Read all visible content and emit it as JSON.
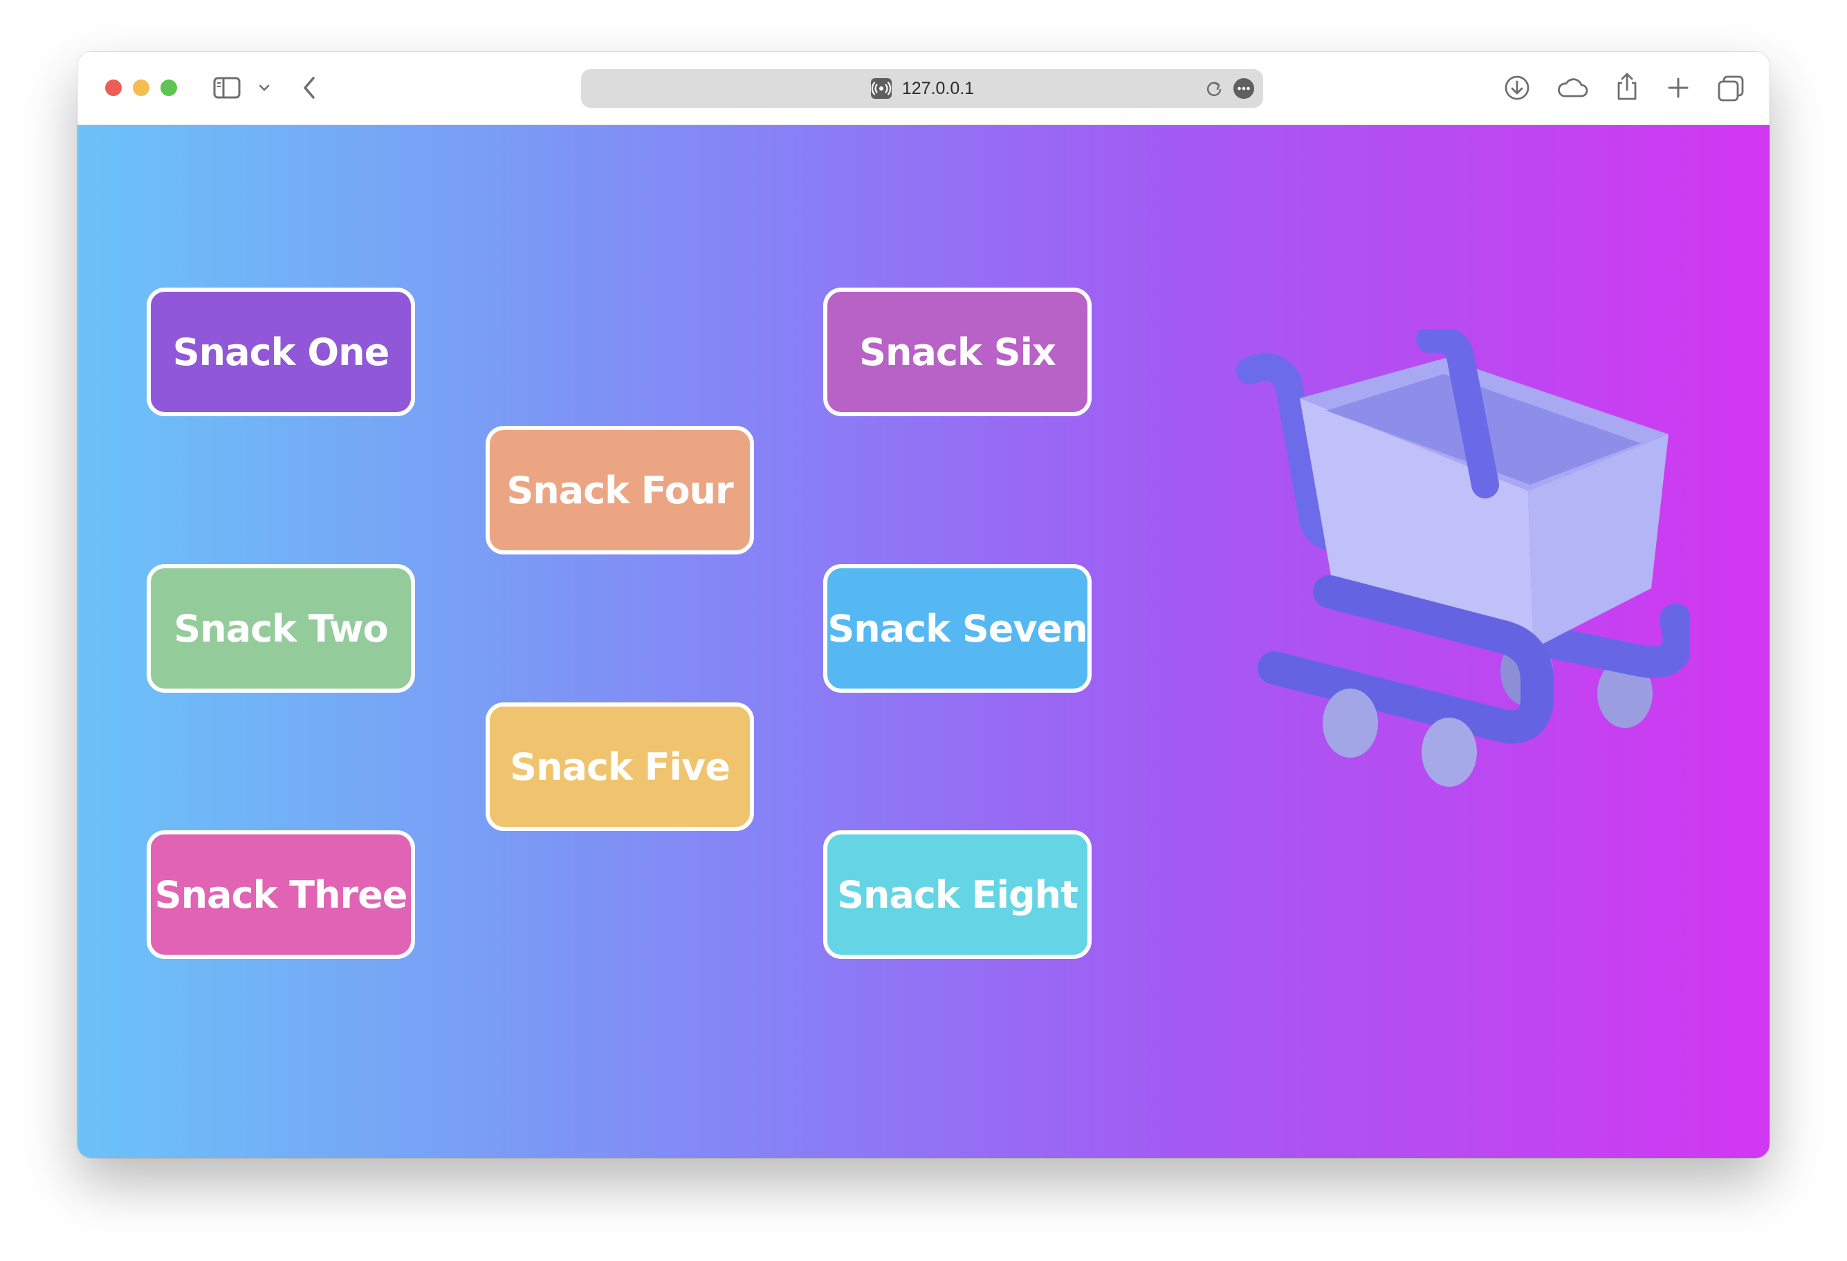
{
  "browser": {
    "url": "127.0.0.1",
    "traffic_lights": {
      "close": "#ed5f56",
      "minimize": "#f5bd4f",
      "zoom": "#5fc454"
    },
    "toolbar_icons": [
      "sidebar-icon",
      "chevron-down-icon",
      "back-icon",
      "download-icon",
      "cloud-icon",
      "share-icon",
      "plus-icon",
      "tabs-icon"
    ]
  },
  "snacks": [
    {
      "label": "Snack One",
      "color": "#9058d8"
    },
    {
      "label": "Snack Two",
      "color": "#94cb9b"
    },
    {
      "label": "Snack Three",
      "color": "#e064b3"
    },
    {
      "label": "Snack Four",
      "color": "#eca582"
    },
    {
      "label": "Snack Five",
      "color": "#f0c46e"
    },
    {
      "label": "Snack Six",
      "color": "#b862c7"
    },
    {
      "label": "Snack Seven",
      "color": "#55b8f2"
    },
    {
      "label": "Snack Eight",
      "color": "#65d5e6"
    }
  ],
  "illustration": "shopping-cart-icon"
}
